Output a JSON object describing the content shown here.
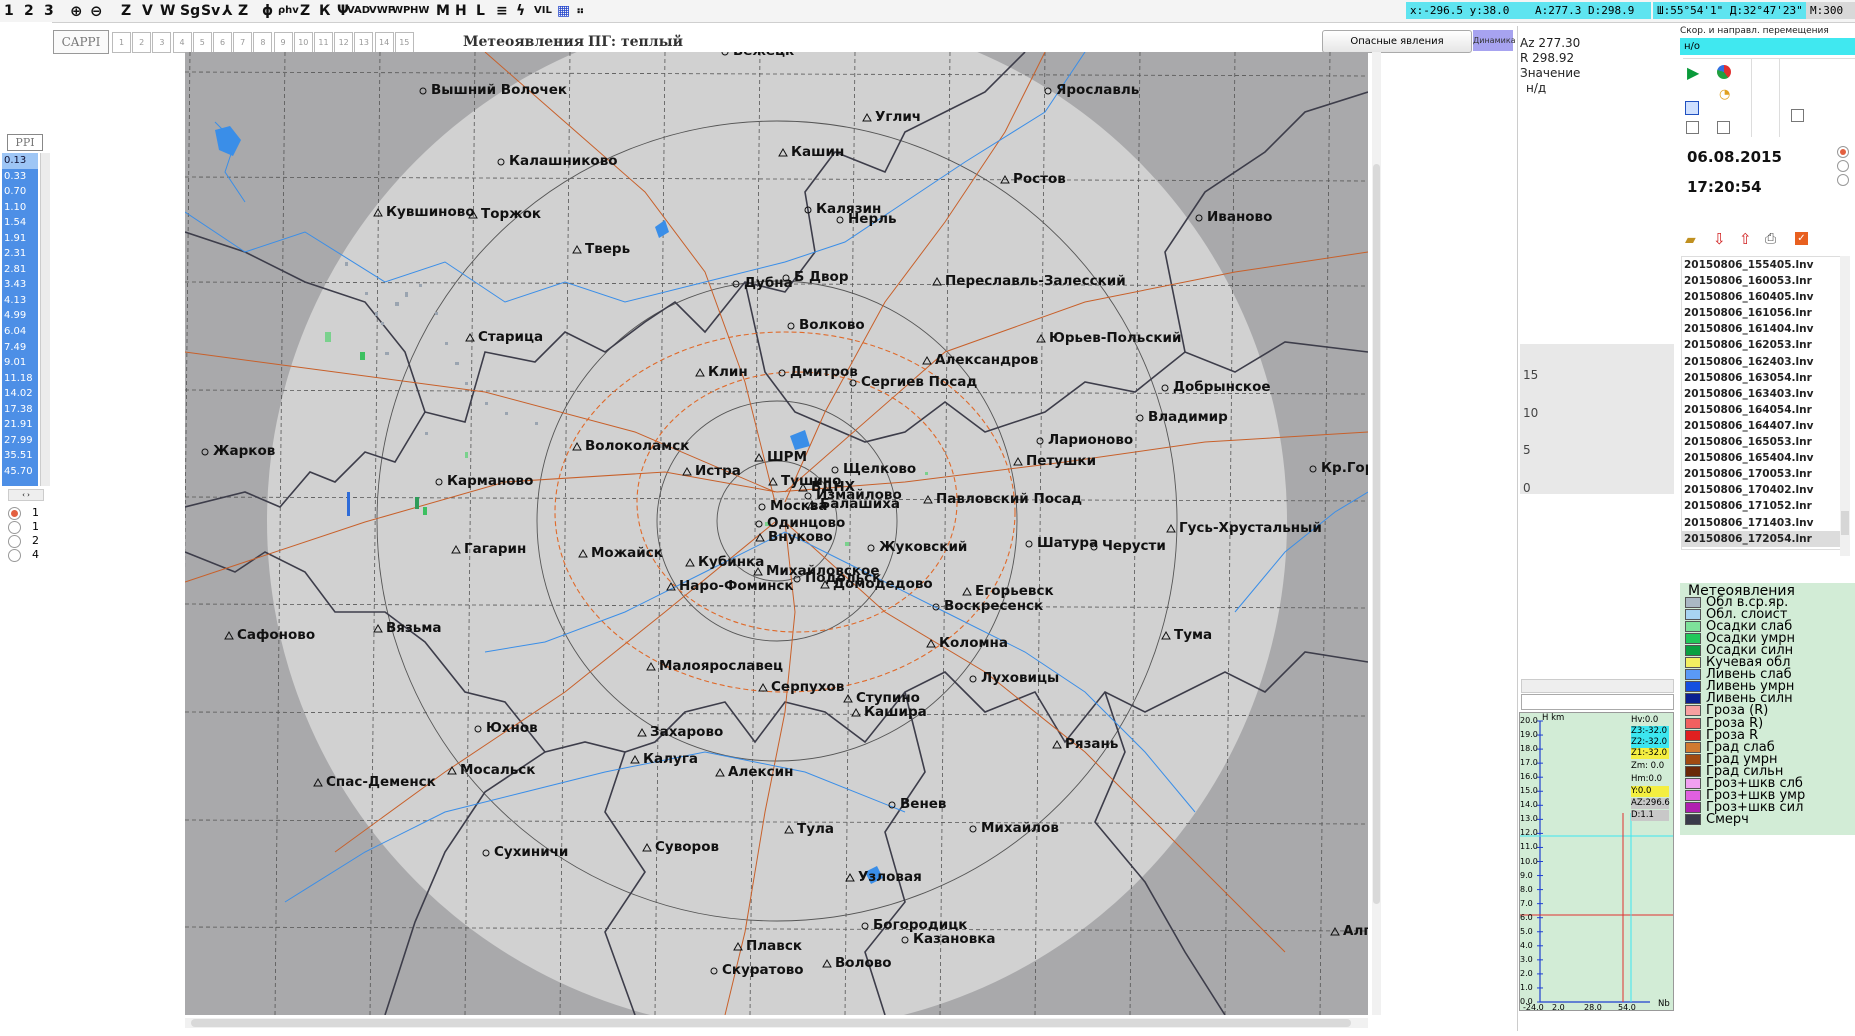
{
  "toolbar": {
    "items": [
      "1",
      "2",
      "3",
      "Z",
      "V",
      "W",
      "Sg",
      "Sv",
      "Z",
      "Z",
      "К",
      "VAD",
      "VWP",
      "WP",
      "HW",
      "M",
      "H",
      "L",
      "VIL"
    ],
    "coord_xy": "x:-296.5 y:38.0",
    "coord_ad": "A:277.3 D:298.9",
    "coord_geo": "Ш:55°54'1\" Д:32°47'23\"",
    "scale": "M:300"
  },
  "left": {
    "ppi_label": "PPI",
    "elevations": [
      "0.13",
      "0.33",
      "0.70",
      "1.10",
      "1.54",
      "1.91",
      "2.31",
      "2.81",
      "3.43",
      "4.13",
      "4.99",
      "6.04",
      "7.49",
      "9.01",
      "11.18",
      "14.02",
      "17.38",
      "21.91",
      "27.99",
      "35.51",
      "45.70"
    ],
    "radios": [
      "1",
      "1",
      "2",
      "4"
    ]
  },
  "header": {
    "cappi_label": "CAPPI",
    "levels": [
      "1",
      "2",
      "3",
      "4",
      "5",
      "6",
      "7",
      "8",
      "9",
      "10",
      "11",
      "12",
      "13",
      "14",
      "15"
    ],
    "title": "Метеоявления",
    "subtitle": "ПГ: теплый",
    "danger_button": "Опасные явления",
    "dynamic_button": "Динамика"
  },
  "map": {
    "cities": [
      {
        "name": "Вышний Волочек"
      },
      {
        "name": "Ярославль"
      },
      {
        "name": "Углич"
      },
      {
        "name": "Калашниково"
      },
      {
        "name": "Кашин"
      },
      {
        "name": "Ростов"
      },
      {
        "name": "Кувшиново"
      },
      {
        "name": "Торжок"
      },
      {
        "name": "Калязин"
      },
      {
        "name": "Нерль"
      },
      {
        "name": "Иваново"
      },
      {
        "name": "Тверь"
      },
      {
        "name": "Дубна"
      },
      {
        "name": "Б Двор"
      },
      {
        "name": "Переславль-Залесский"
      },
      {
        "name": "Волково"
      },
      {
        "name": "Старица"
      },
      {
        "name": "Юрьев-Польский"
      },
      {
        "name": "Александров"
      },
      {
        "name": "Клин"
      },
      {
        "name": "Дмитров"
      },
      {
        "name": "Сергиев Посад"
      },
      {
        "name": "Добрынское"
      },
      {
        "name": "Владимир"
      },
      {
        "name": "Жарков"
      },
      {
        "name": "Волоколамск"
      },
      {
        "name": "Ларионово"
      },
      {
        "name": "Петушки"
      },
      {
        "name": "ШРМ"
      },
      {
        "name": "Истра"
      },
      {
        "name": "Щелково"
      },
      {
        "name": "Кр.Горб"
      },
      {
        "name": "Карманово"
      },
      {
        "name": "Тушино"
      },
      {
        "name": "ВДНХ"
      },
      {
        "name": "Измайлово"
      },
      {
        "name": "Павловский Посад"
      },
      {
        "name": "Москва"
      },
      {
        "name": "Балашиха"
      },
      {
        "name": "Гусь-Хрустальный"
      },
      {
        "name": "Одинцово"
      },
      {
        "name": "Внуково"
      },
      {
        "name": "Шатура"
      },
      {
        "name": "Черусти"
      },
      {
        "name": "Гагарин"
      },
      {
        "name": "Можайск"
      },
      {
        "name": "Жуковский"
      },
      {
        "name": "Кубинка"
      },
      {
        "name": "Михайловское"
      },
      {
        "name": "Подольск"
      },
      {
        "name": "Наро-Фоминск"
      },
      {
        "name": "Домодедово"
      },
      {
        "name": "Егорьевск"
      },
      {
        "name": "Воскресенск"
      },
      {
        "name": "Сафоново"
      },
      {
        "name": "Вязьма"
      },
      {
        "name": "Тума"
      },
      {
        "name": "Коломна"
      },
      {
        "name": "Малоярославец"
      },
      {
        "name": "Луховицы"
      },
      {
        "name": "Серпухов"
      },
      {
        "name": "Ступино"
      },
      {
        "name": "Кашира"
      },
      {
        "name": "Юхнов"
      },
      {
        "name": "Захарово"
      },
      {
        "name": "Рязань"
      },
      {
        "name": "Калуга"
      },
      {
        "name": "Мосальск"
      },
      {
        "name": "Алексин"
      },
      {
        "name": "Спас-Деменск"
      },
      {
        "name": "Венев"
      },
      {
        "name": "Михайлов"
      },
      {
        "name": "Тула"
      },
      {
        "name": "Сухиничи"
      },
      {
        "name": "Суворов"
      },
      {
        "name": "Узловая"
      },
      {
        "name": "Богородицк"
      },
      {
        "name": "Казановка"
      },
      {
        "name": "Алга"
      },
      {
        "name": "Плавск"
      },
      {
        "name": "Волово"
      },
      {
        "name": "Скуратово"
      },
      {
        "name": "Бежецк"
      }
    ]
  },
  "right": {
    "az": "Az 277.30",
    "r": "R 298.92",
    "value_label": "Значение",
    "value": "н/д",
    "axis": [
      "15",
      "10",
      "5",
      "0"
    ],
    "speed_header": "Скор. и направл. перемещения",
    "speed_value": "н/о",
    "date": "06.08.2015",
    "time": "17:20:54",
    "files": [
      "20150806_155405.lnv",
      "20150806_160053.lnr",
      "20150806_160405.lnv",
      "20150806_161056.lnr",
      "20150806_161404.lnv",
      "20150806_162053.lnr",
      "20150806_162403.lnv",
      "20150806_163054.lnr",
      "20150806_163403.lnv",
      "20150806_164054.lnr",
      "20150806_164407.lnv",
      "20150806_165053.lnr",
      "20150806_165404.lnv",
      "20150806_170053.lnr",
      "20150806_170402.lnv",
      "20150806_171052.lnr",
      "20150806_171403.lnv",
      "20150806_172054.lnr"
    ],
    "meteo_title": "Метеоявления",
    "legend": [
      {
        "label": "Обл в.ср.яр.",
        "color": "#aab8c4"
      },
      {
        "label": "Обл. слоист",
        "color": "#a8d4f2"
      },
      {
        "label": "Осадки слаб",
        "color": "#7ee29a"
      },
      {
        "label": "Осадки умрн",
        "color": "#22c85a"
      },
      {
        "label": "Осадки силн",
        "color": "#0aa040"
      },
      {
        "label": "Кучевая обл",
        "color": "#f2f060"
      },
      {
        "label": "Ливень слаб",
        "color": "#5a9af6"
      },
      {
        "label": "Ливень умрн",
        "color": "#1450e0"
      },
      {
        "label": "Ливень силн",
        "color": "#0a2090"
      },
      {
        "label": "Гроза  (R)",
        "color": "#f8a0a0"
      },
      {
        "label": "Гроза  R)",
        "color": "#f06060"
      },
      {
        "label": "Гроза  R",
        "color": "#e02020"
      },
      {
        "label": "Град слаб",
        "color": "#d07a30"
      },
      {
        "label": "Град умрн",
        "color": "#a04a10"
      },
      {
        "label": "Град сильн",
        "color": "#6a2808"
      },
      {
        "label": "Гроз+шкв слб",
        "color": "#f0a0f0"
      },
      {
        "label": "Гроз+шкв умр",
        "color": "#e060e0"
      },
      {
        "label": "Гроз+шкв сил",
        "color": "#b020b0"
      },
      {
        "label": "Смерч",
        "color": "#3a3a4a"
      }
    ],
    "vprof": {
      "h_label": "H km",
      "yticks": [
        "20.0",
        "19.0",
        "18.0",
        "17.0",
        "16.0",
        "15.0",
        "14.0",
        "13.0",
        "12.0",
        "11.0",
        "10.0",
        "9.0",
        "8.0",
        "7.0",
        "6.0",
        "5.0",
        "4.0",
        "3.0",
        "2.0",
        "1.0",
        "0.0"
      ],
      "xticks": [
        "-24.0",
        "2.0",
        "28.0",
        "54.0"
      ],
      "x_unit": "Nb",
      "hv": "Hv:0.0",
      "z3": "Z3:-32.0",
      "z2": "Z2:-32.0",
      "z1": "Z1:-32.0",
      "zm": "Zm:  0.0",
      "hm": "Hm:0.0",
      "y": "Y:0.0",
      "az": "AZ:296.6",
      "d": "D:1.1"
    }
  }
}
